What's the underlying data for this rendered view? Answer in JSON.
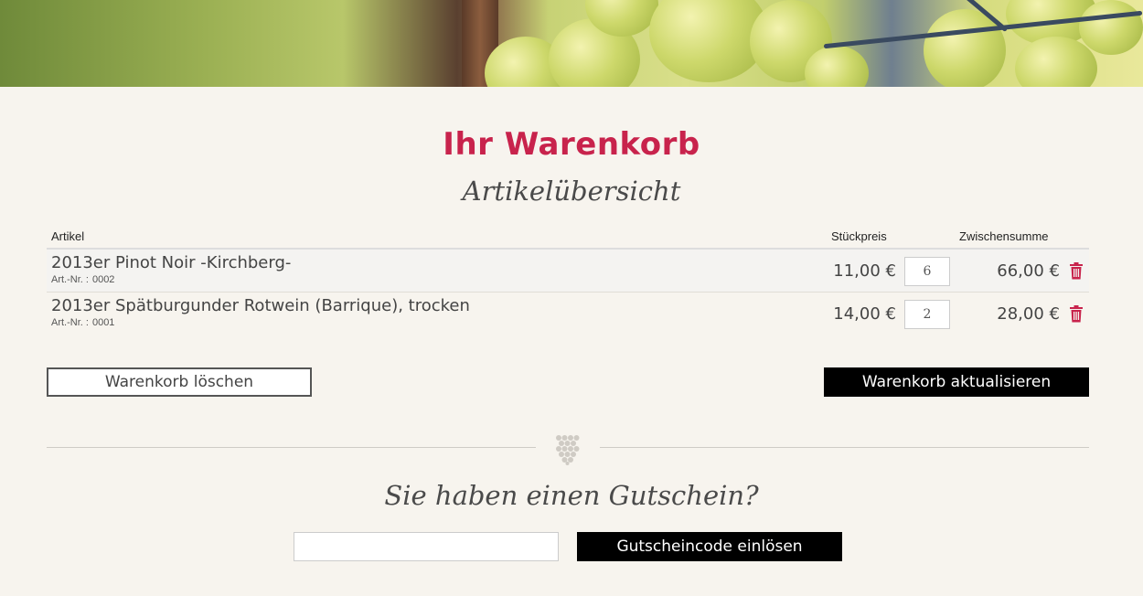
{
  "page": {
    "title": "Ihr Warenkorb",
    "subtitle": "Artikelübersicht"
  },
  "colors": {
    "accent": "#c8234c",
    "background": "#f7f4ee",
    "button_dark": "#000000"
  },
  "table": {
    "headers": {
      "article": "Artikel",
      "unit_price": "Stückpreis",
      "subtotal": "Zwischensumme"
    },
    "rows": [
      {
        "name": "2013er Pinot Noir -Kirchberg-",
        "artno_label": "Art.-Nr. :",
        "artno": "0002",
        "price": "11,00 €",
        "quantity": "6",
        "subtotal": "66,00 €",
        "delete_icon": "trash-icon"
      },
      {
        "name": "2013er Spätburgunder Rotwein (Barrique), trocken",
        "artno_label": "Art.-Nr. :",
        "artno": "0001",
        "price": "14,00 €",
        "quantity": "2",
        "subtotal": "28,00 €",
        "delete_icon": "trash-icon"
      }
    ]
  },
  "actions": {
    "clear_cart": "Warenkorb löschen",
    "update_cart": "Warenkorb aktualisieren"
  },
  "coupon": {
    "title": "Sie haben einen Gutschein?",
    "input_value": "",
    "redeem_button": "Gutscheincode einlösen"
  }
}
